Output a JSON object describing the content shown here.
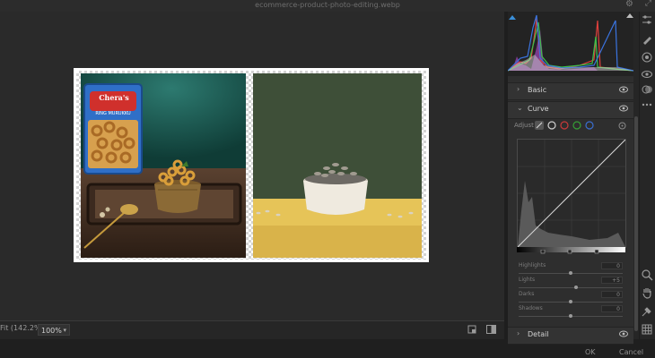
{
  "window": {
    "title": "ecommerce-product-photo-editing.webp"
  },
  "photos": {
    "left": {
      "bag_brand": "Chera's",
      "bag_product": "RING MURUKKU"
    }
  },
  "view": {
    "fit_label": "Fit (142.2%)",
    "zoom_value": "100%"
  },
  "panel": {
    "sections": {
      "basic": "Basic",
      "curve": "Curve",
      "detail": "Detail"
    },
    "curve": {
      "adjust_label": "Adjust",
      "channels": [
        "point",
        "white",
        "red",
        "green",
        "blue"
      ],
      "channel_colors": {
        "white": "#d0d0d0",
        "red": "#c93a3a",
        "green": "#35a035",
        "blue": "#3a6ed0"
      },
      "sliders": [
        {
          "label": "Highlights",
          "value": "0",
          "level": 0.5
        },
        {
          "label": "Lights",
          "value": "+5",
          "level": 0.55
        },
        {
          "label": "Darks",
          "value": "0",
          "level": 0.5
        },
        {
          "label": "Shadows",
          "value": "0",
          "level": 0.5
        }
      ]
    }
  },
  "footer": {
    "ok": "OK",
    "cancel": "Cancel"
  },
  "colors": {
    "accent": "#3a8fd9",
    "canvas": "#2a2a2a",
    "panel": "#2e2e2e"
  }
}
